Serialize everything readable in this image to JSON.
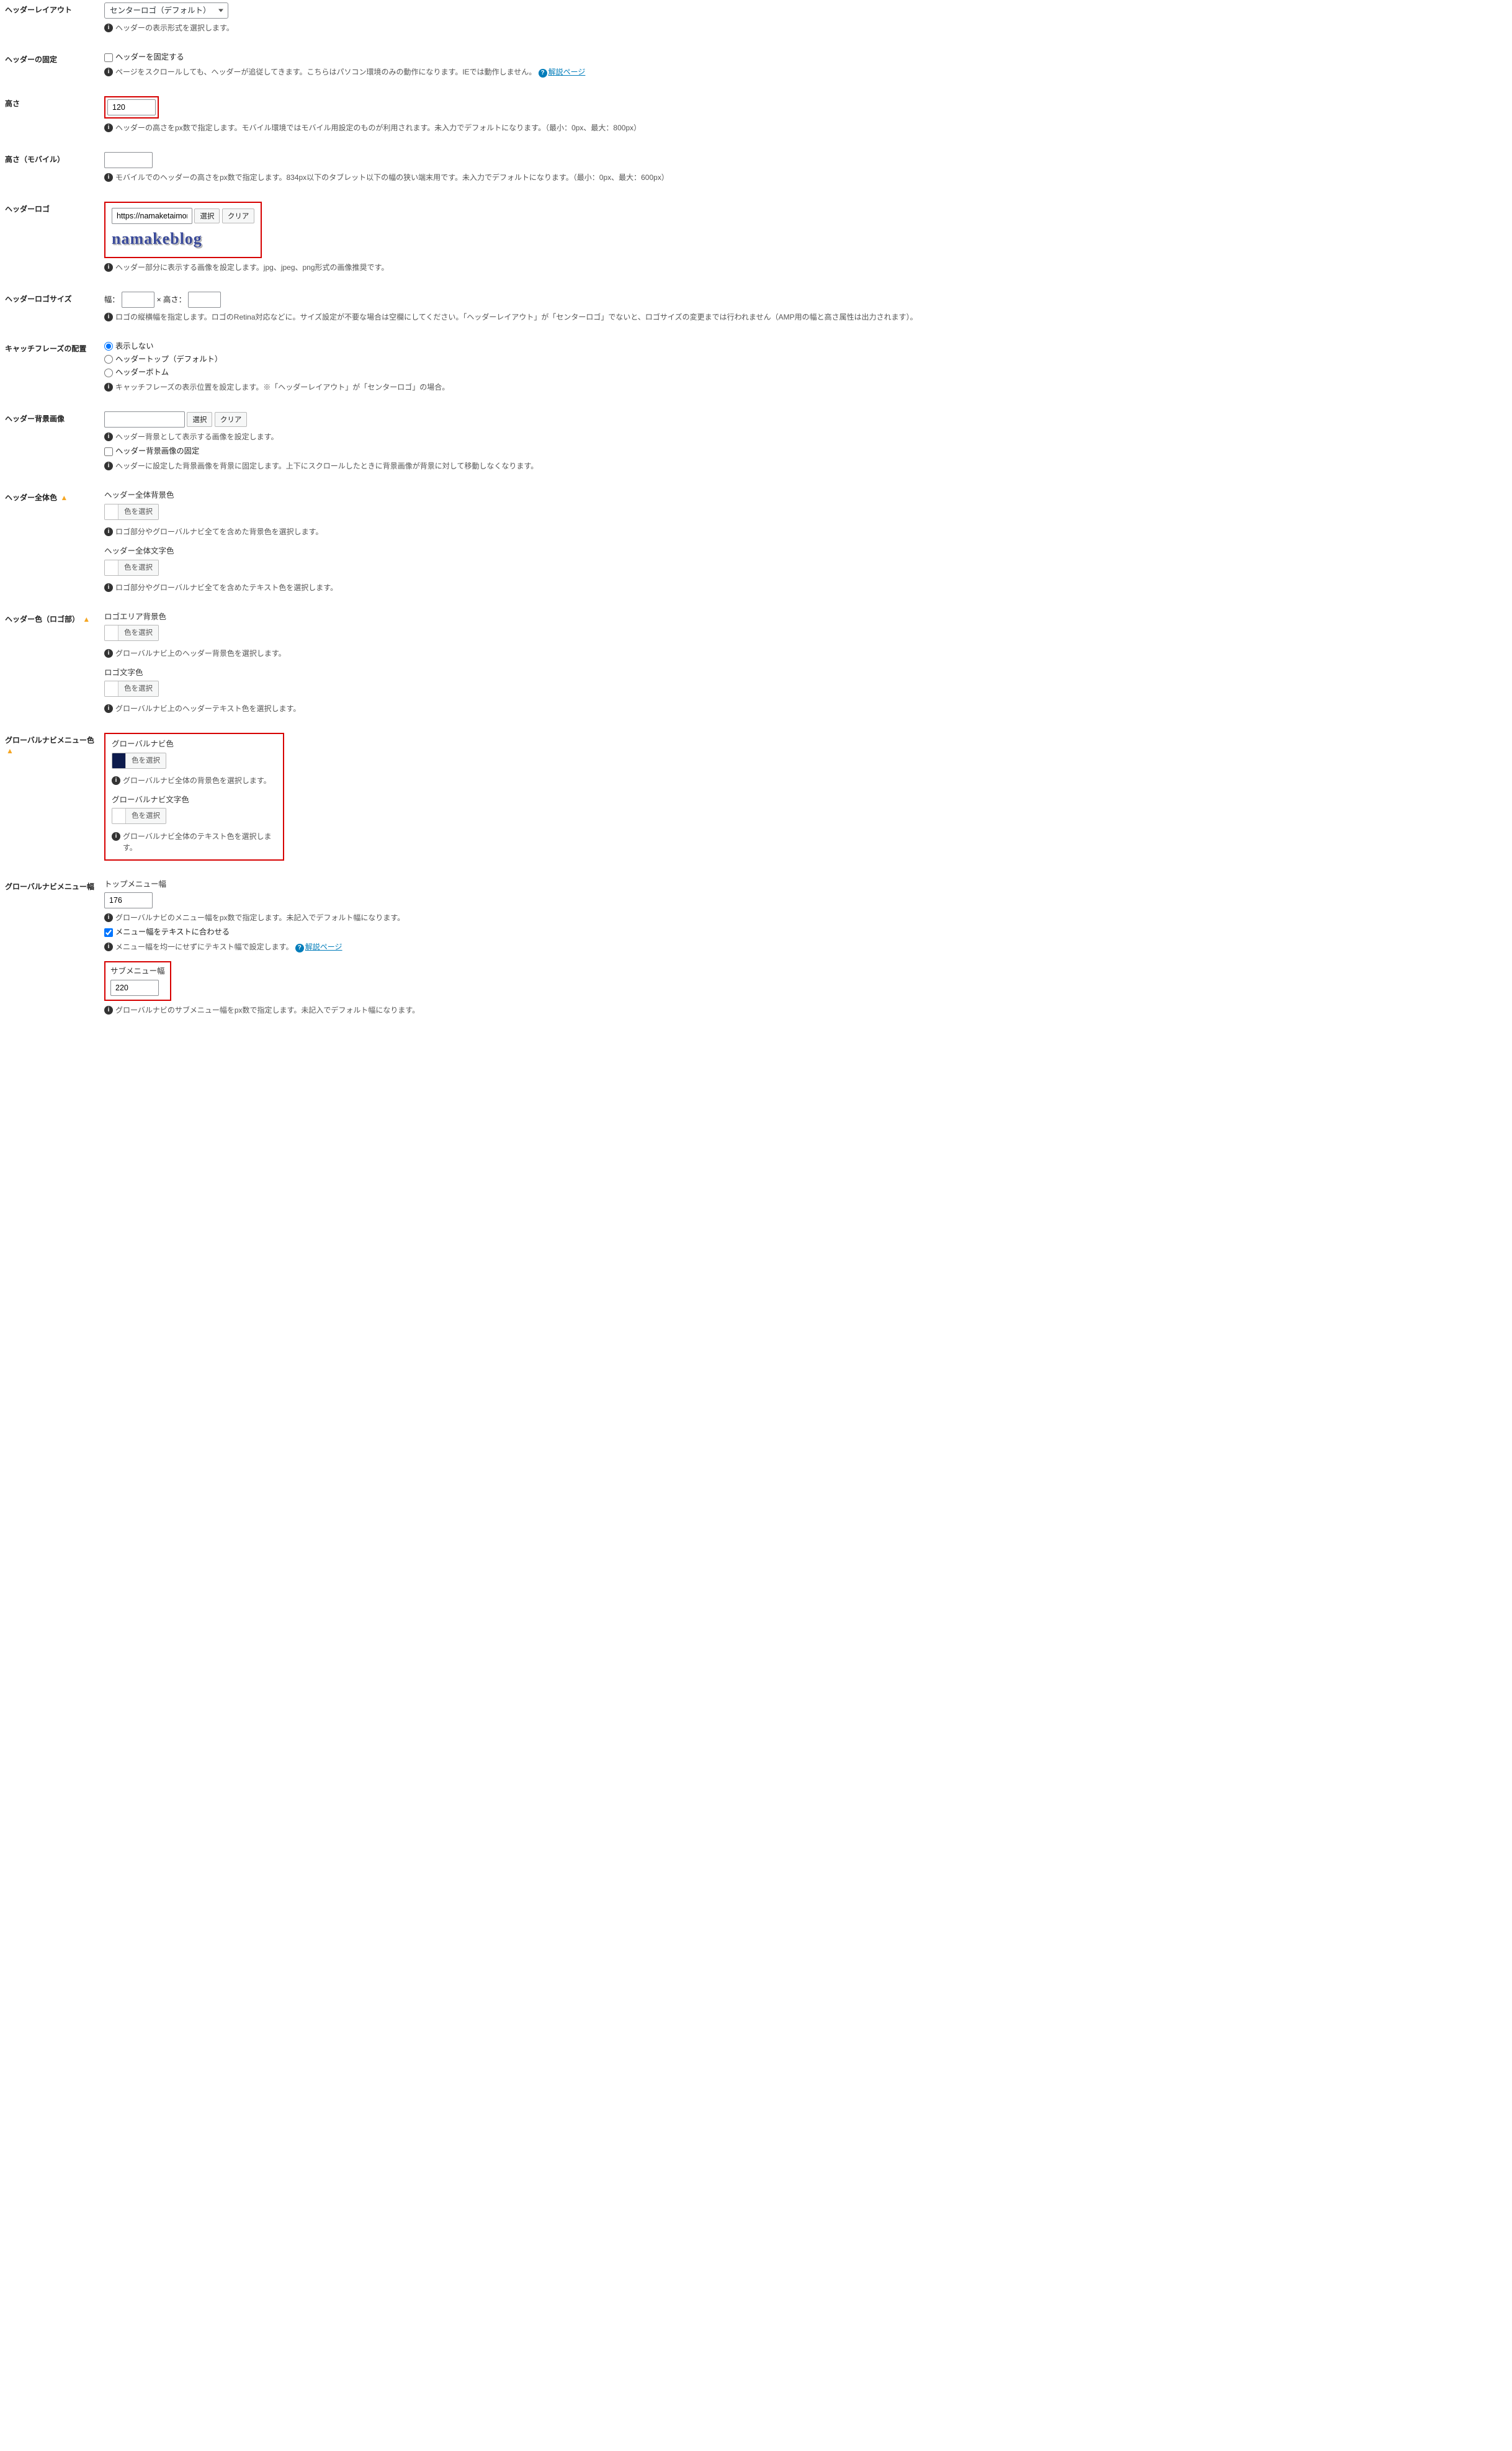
{
  "header_layout": {
    "label": "ヘッダーレイアウト",
    "select": "センターロゴ（デフォルト）",
    "desc": "ヘッダーの表示形式を選択します。"
  },
  "header_fixed": {
    "label": "ヘッダーの固定",
    "checkbox": "ヘッダーを固定する",
    "desc": "ページをスクロールしても、ヘッダーが追従してきます。こちらはパソコン環境のみの動作になります。IEでは動作しません。",
    "help": "解説ページ"
  },
  "height": {
    "label": "高さ",
    "value": "120",
    "desc": "ヘッダーの高さをpx数で指定します。モバイル環境ではモバイル用設定のものが利用されます。未入力でデフォルトになります。（最小：0px、最大：800px）"
  },
  "height_mobile": {
    "label": "高さ（モバイル）",
    "desc": "モバイルでのヘッダーの高さをpx数で指定します。834px以下のタブレット以下の幅の狭い端末用です。未入力でデフォルトになります。（最小：0px、最大：600px）"
  },
  "header_logo": {
    "label": "ヘッダーロゴ",
    "url": "https://namaketaimono.cc",
    "btn_select": "選択",
    "btn_clear": "クリア",
    "logo_text": "namakeblog",
    "desc": "ヘッダー部分に表示する画像を設定します。jpg、jpeg、png形式の画像推奨です。"
  },
  "logo_size": {
    "label": "ヘッダーロゴサイズ",
    "width_label": "幅：",
    "height_sep": "× 高さ：",
    "desc": "ロゴの縦横幅を指定します。ロゴのRetina対応などに。サイズ設定が不要な場合は空欄にしてください。「ヘッダーレイアウト」が「センターロゴ」でないと、ロゴサイズの変更までは行われません（AMP用の幅と高さ属性は出力されます）。"
  },
  "catchphrase": {
    "label": "キャッチフレーズの配置",
    "opt1": "表示しない",
    "opt2": "ヘッダートップ（デフォルト）",
    "opt3": "ヘッダーボトム",
    "desc": "キャッチフレーズの表示位置を設定します。※「ヘッダーレイアウト」が「センターロゴ」の場合。"
  },
  "header_bg": {
    "label": "ヘッダー背景画像",
    "btn_select": "選択",
    "btn_clear": "クリア",
    "desc1": "ヘッダー背景として表示する画像を設定します。",
    "checkbox": "ヘッダー背景画像の固定",
    "desc2": "ヘッダーに設定した背景画像を背景に固定します。上下にスクロールしたときに背景画像が背景に対して移動しなくなります。"
  },
  "header_all_color": {
    "label": "ヘッダー全体色",
    "sub1": "ヘッダー全体背景色",
    "pick": "色を選択",
    "desc1": "ロゴ部分やグローバルナビ全てを含めた背景色を選択します。",
    "sub2": "ヘッダー全体文字色",
    "desc2": "ロゴ部分やグローバルナビ全てを含めたテキスト色を選択します。"
  },
  "header_logo_color": {
    "label": "ヘッダー色（ロゴ部）",
    "sub1": "ロゴエリア背景色",
    "pick": "色を選択",
    "desc1": "グローバルナビ上のヘッダー背景色を選択します。",
    "sub2": "ロゴ文字色",
    "desc2": "グローバルナビ上のヘッダーテキスト色を選択します。"
  },
  "gnav_color": {
    "label": "グローバルナビメニュー色",
    "sub1": "グローバルナビ色",
    "pick": "色を選択",
    "desc1": "グローバルナビ全体の背景色を選択します。",
    "sub2": "グローバルナビ文字色",
    "desc2": "グローバルナビ全体のテキスト色を選択します。"
  },
  "gnav_width": {
    "label": "グローバルナビメニュー幅",
    "sub1": "トップメニュー幅",
    "val1": "176",
    "desc1": "グローバルナビのメニュー幅をpx数で指定します。未記入でデフォルト幅になります。",
    "checkbox": "メニュー幅をテキストに合わせる",
    "desc2": "メニュー幅を均一にせずにテキスト幅で設定します。",
    "help": "解説ページ",
    "sub2": "サブメニュー幅",
    "val2": "220",
    "desc3": "グローバルナビのサブメニュー幅をpx数で指定します。未記入でデフォルト幅になります。"
  }
}
